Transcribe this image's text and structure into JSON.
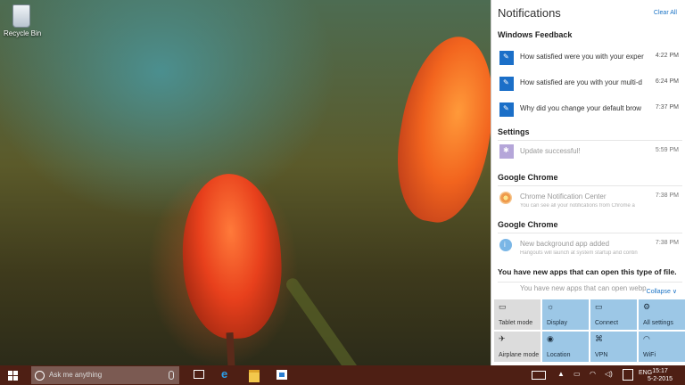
{
  "desktop": {
    "recycle_bin_label": "Recycle Bin"
  },
  "action_center": {
    "title": "Notifications",
    "clear_all": "Clear All",
    "groups": [
      {
        "title": "Windows Feedback",
        "items": [
          {
            "text": "How satisfied were you with your exper",
            "time": "4:22 PM"
          },
          {
            "text": "How satisfied are you with your multi-d",
            "time": "6:24 PM"
          },
          {
            "text": "Why did you change your default brow",
            "time": "7:37 PM"
          }
        ]
      },
      {
        "title": "Settings",
        "items": [
          {
            "text": "Update successful!",
            "time": "5:59 PM"
          }
        ]
      },
      {
        "title": "Google Chrome",
        "items": [
          {
            "text": "Chrome Notification Center",
            "sub": "You can see all your notifications from Chrome a",
            "time": "7:38 PM"
          }
        ]
      },
      {
        "title": "Google Chrome",
        "items": [
          {
            "text": "New background app added",
            "sub": "Hangouts will launch at system startup and contin",
            "time": "7:38 PM"
          }
        ]
      },
      {
        "title": "You have new apps that can open this type of file.",
        "items": [
          {
            "text": "You have new apps that can open webp",
            "time": ""
          }
        ]
      }
    ],
    "collapse": "Collapse",
    "quick_actions": [
      {
        "label": "Tablet mode",
        "icon": "tablet-mode-icon",
        "state": "off"
      },
      {
        "label": "Display",
        "icon": "display-icon",
        "state": "on"
      },
      {
        "label": "Connect",
        "icon": "connect-icon",
        "state": "on"
      },
      {
        "label": "All settings",
        "icon": "settings-icon",
        "state": "on"
      },
      {
        "label": "Airplane mode",
        "icon": "airplane-icon",
        "state": "off"
      },
      {
        "label": "Location",
        "icon": "location-icon",
        "state": "on"
      },
      {
        "label": "VPN",
        "icon": "vpn-icon",
        "state": "on"
      },
      {
        "label": "WiFi",
        "icon": "wifi-icon",
        "state": "on"
      }
    ]
  },
  "taskbar": {
    "search_placeholder": "Ask me anything",
    "language": "ENG",
    "time": "15:17",
    "date": "5-2-2015",
    "colors": {
      "taskbar": "#4e1f14",
      "accent": "#9cc7e6"
    }
  }
}
